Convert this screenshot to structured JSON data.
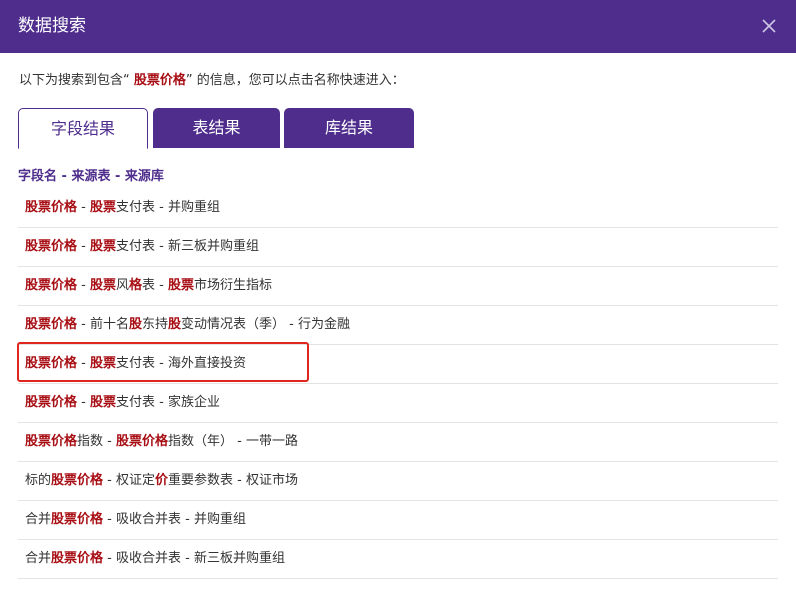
{
  "dialog": {
    "title": "数据搜索",
    "close_icon": "close-icon"
  },
  "intro": {
    "prefix": "以下为搜索到包含“ ",
    "keyword": "股票价格",
    "suffix": "” 的信息，您可以点击名称快速进入："
  },
  "tabs": [
    {
      "label": "字段结果",
      "active": true
    },
    {
      "label": "表结果",
      "active": false
    },
    {
      "label": "库结果",
      "active": false
    }
  ],
  "column_header": "字段名 - 来源表 - 来源库",
  "rows": [
    {
      "segments": [
        {
          "t": "股票价格",
          "h": true
        },
        {
          "t": " - ",
          "h": false
        },
        {
          "t": "股票",
          "h": true
        },
        {
          "t": "支付表 - 并购重组",
          "h": false
        }
      ]
    },
    {
      "segments": [
        {
          "t": "股票价格",
          "h": true
        },
        {
          "t": " - ",
          "h": false
        },
        {
          "t": "股票",
          "h": true
        },
        {
          "t": "支付表 - 新三板并购重组",
          "h": false
        }
      ]
    },
    {
      "segments": [
        {
          "t": "股票价格",
          "h": true
        },
        {
          "t": " - ",
          "h": false
        },
        {
          "t": "股票",
          "h": true
        },
        {
          "t": "风",
          "h": false
        },
        {
          "t": "格",
          "h": true
        },
        {
          "t": "表 - ",
          "h": false
        },
        {
          "t": "股票",
          "h": true
        },
        {
          "t": "市场衍生指标",
          "h": false
        }
      ]
    },
    {
      "segments": [
        {
          "t": "股票价格",
          "h": true
        },
        {
          "t": " - 前十名",
          "h": false
        },
        {
          "t": "股",
          "h": true
        },
        {
          "t": "东持",
          "h": false
        },
        {
          "t": "股",
          "h": true
        },
        {
          "t": "变动情况表（季） - 行为金融",
          "h": false
        }
      ]
    },
    {
      "segments": [
        {
          "t": "股票价格",
          "h": true
        },
        {
          "t": " - ",
          "h": false
        },
        {
          "t": "股票",
          "h": true
        },
        {
          "t": "支付表 - 海外直接投资",
          "h": false
        }
      ],
      "boxed": true
    },
    {
      "segments": [
        {
          "t": "股票价格",
          "h": true
        },
        {
          "t": " - ",
          "h": false
        },
        {
          "t": "股票",
          "h": true
        },
        {
          "t": "支付表 - 家族企业",
          "h": false
        }
      ]
    },
    {
      "segments": [
        {
          "t": "股票价格",
          "h": true
        },
        {
          "t": "指数 - ",
          "h": false
        },
        {
          "t": "股票价格",
          "h": true
        },
        {
          "t": "指数（年） - 一带一路",
          "h": false
        }
      ]
    },
    {
      "segments": [
        {
          "t": "标的",
          "h": false
        },
        {
          "t": "股票价格",
          "h": true
        },
        {
          "t": " - 权证定",
          "h": false
        },
        {
          "t": "价",
          "h": true
        },
        {
          "t": "重要参数表 - 权证市场",
          "h": false
        }
      ]
    },
    {
      "segments": [
        {
          "t": "合并",
          "h": false
        },
        {
          "t": "股票价格",
          "h": true
        },
        {
          "t": " - 吸收合并表 - 并购重组",
          "h": false
        }
      ]
    },
    {
      "segments": [
        {
          "t": "合并",
          "h": false
        },
        {
          "t": "股票价格",
          "h": true
        },
        {
          "t": " - 吸收合并表 - 新三板并购重组",
          "h": false
        }
      ]
    }
  ],
  "colors": {
    "brand": "#4e2d8c",
    "keyword": "#a80f15",
    "highlight_box": "#e0261e"
  }
}
